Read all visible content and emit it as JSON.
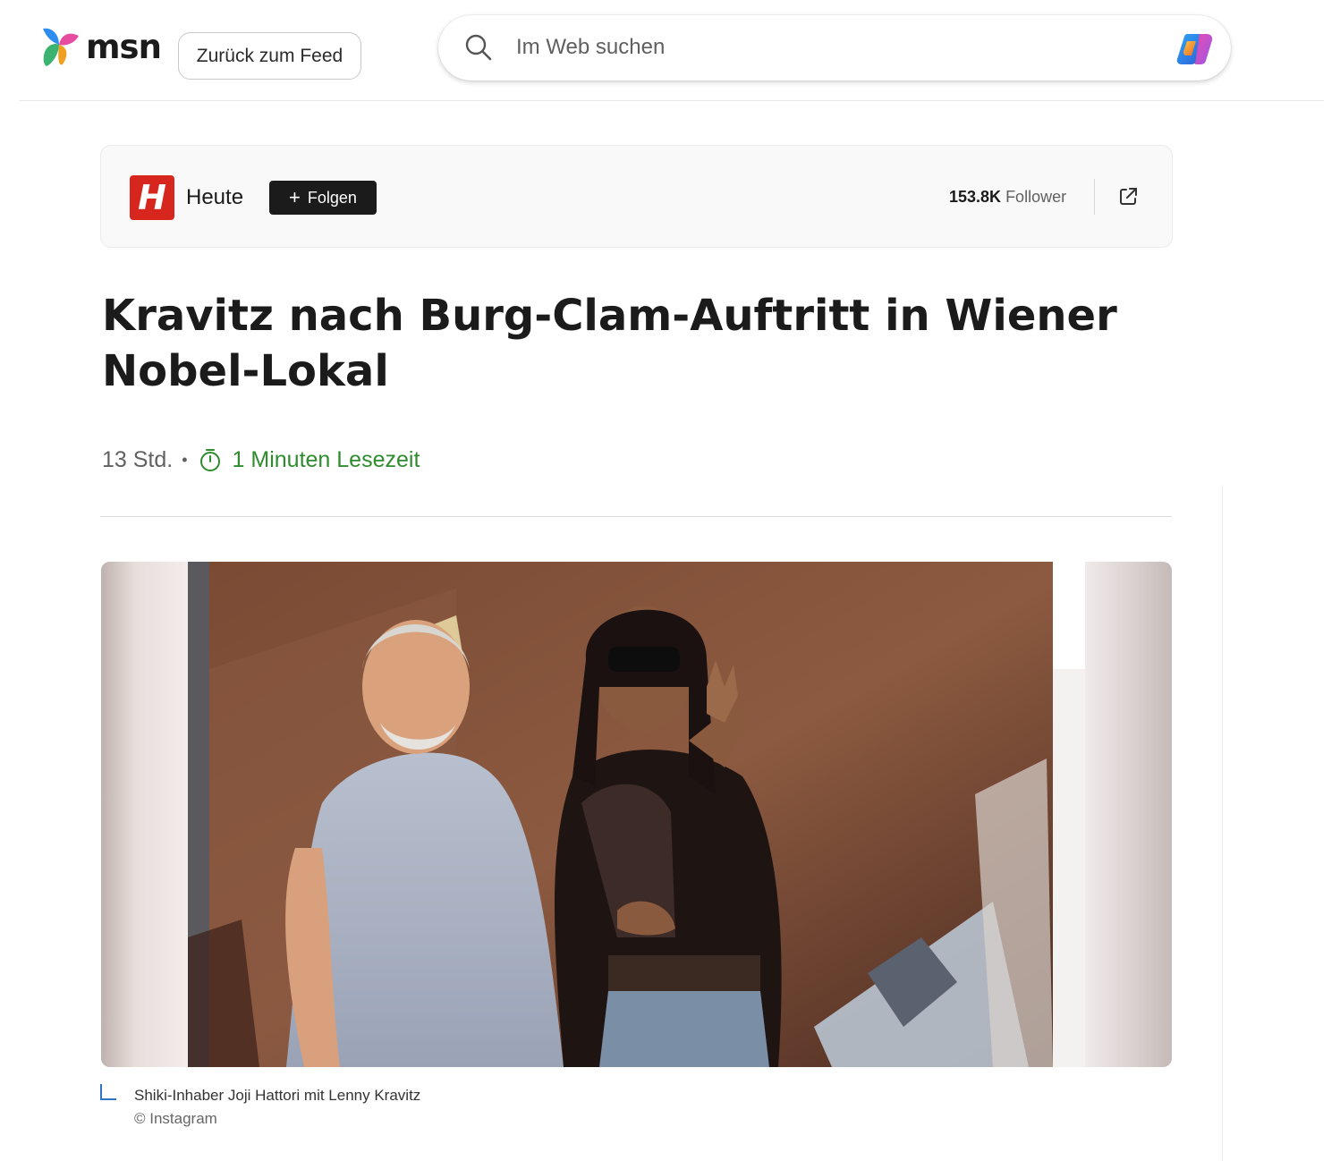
{
  "header": {
    "logo_text": "msn",
    "back_label": "Zurück zum Feed",
    "search_placeholder": "Im Web suchen"
  },
  "publisher": {
    "logo_letter": "H",
    "name": "Heute",
    "follow_label": "Folgen",
    "follower_count": "153.8K",
    "follower_label": "Follower"
  },
  "article": {
    "title": "Kravitz nach Burg-Clam-Auftritt in Wiener Nobel-Lokal",
    "age": "13 Std.",
    "read_time": "1 Minuten Lesezeit",
    "image_caption": "Shiki-Inhaber Joji Hattori mit Lenny Kravitz",
    "image_credit": "© Instagram"
  },
  "colors": {
    "accent_green": "#2e8b2e",
    "publisher_red": "#d7261e",
    "caption_blue": "#2f73c8"
  },
  "icons": [
    "msn-butterfly-icon",
    "search-icon",
    "copilot-icon",
    "open-external-icon",
    "timer-icon"
  ]
}
